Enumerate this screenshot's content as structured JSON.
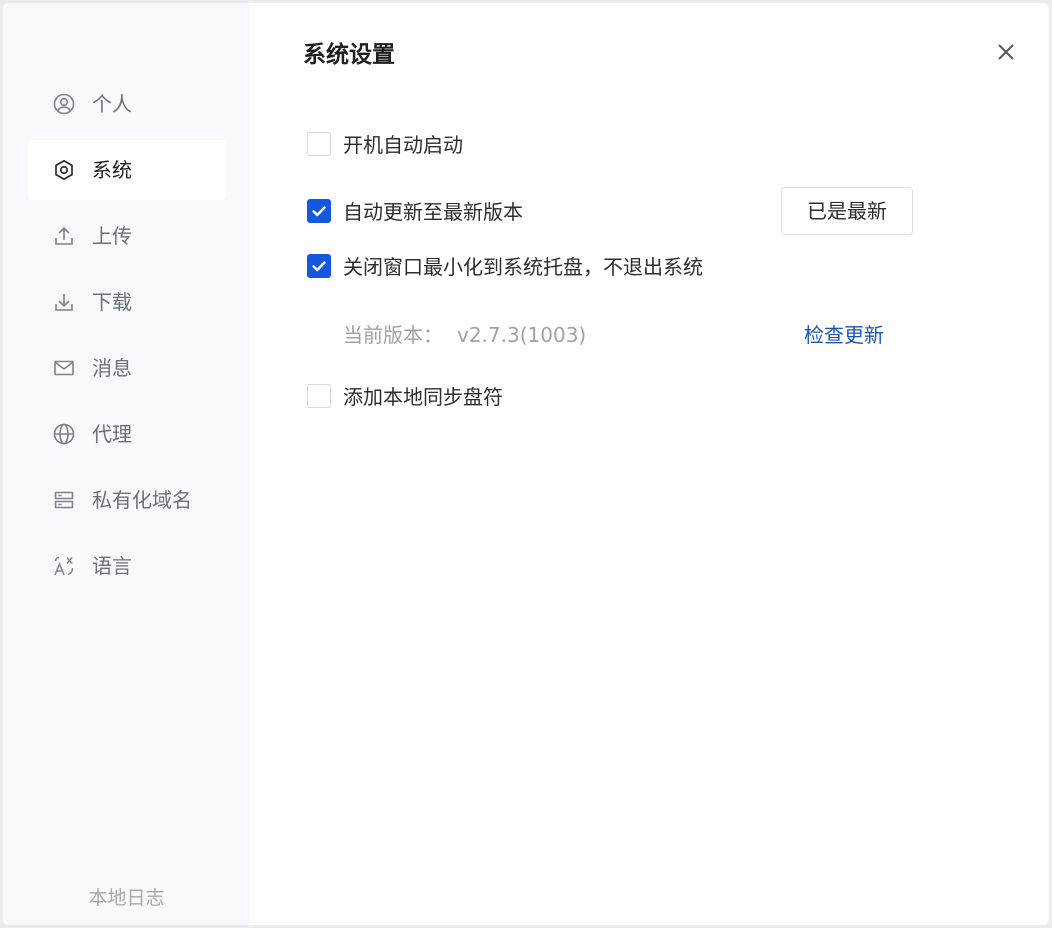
{
  "sidebar": {
    "items": [
      {
        "label": "个人",
        "icon": "user-circle-icon"
      },
      {
        "label": "系统",
        "icon": "hexagon-settings-icon",
        "active": true
      },
      {
        "label": "上传",
        "icon": "upload-icon"
      },
      {
        "label": "下载",
        "icon": "download-icon"
      },
      {
        "label": "消息",
        "icon": "mail-icon"
      },
      {
        "label": "代理",
        "icon": "globe-icon"
      },
      {
        "label": "私有化域名",
        "icon": "server-icon"
      },
      {
        "label": "语言",
        "icon": "translate-icon"
      }
    ],
    "footer_link": "本地日志"
  },
  "main": {
    "title": "系统设置",
    "options": [
      {
        "label": "开机自动启动",
        "checked": false
      },
      {
        "label": "自动更新至最新版本",
        "checked": true
      },
      {
        "label": "关闭窗口最小化到系统托盘，不退出系统",
        "checked": true
      },
      {
        "label": "添加本地同步盘符",
        "checked": false
      }
    ],
    "latest_button": "已是最新",
    "version_label": "当前版本：",
    "version_value": "v2.7.3(1003)",
    "check_update": "检查更新"
  },
  "colors": {
    "accent": "#1558e0",
    "link": "#1b56b8",
    "sidebar_bg": "#f7f9fc"
  }
}
